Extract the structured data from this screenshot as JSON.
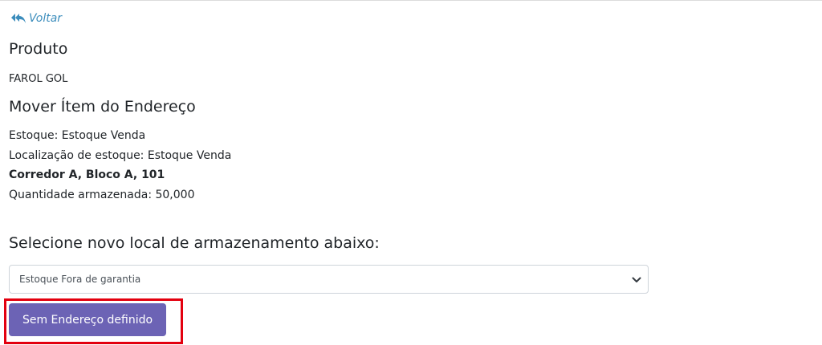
{
  "nav": {
    "back_label": "Voltar",
    "back_icon": "reply-all-icon",
    "link_color": "#3c8dbc"
  },
  "produto": {
    "heading": "Produto",
    "name": "FAROL GOL"
  },
  "mover": {
    "heading": "Mover Ítem do Endereço",
    "estoque": "Estoque: Estoque Venda",
    "localizacao": "Localização de estoque: Estoque Venda",
    "endereco": "Corredor A, Bloco A, 101",
    "quantidade": "Quantidade armazenada: 50,000"
  },
  "novo_local": {
    "heading": "Selecione novo local de armazenamento abaixo:",
    "select_value": "Estoque Fora de garantia",
    "select_icon": "chevron-down-icon"
  },
  "actions": {
    "no_address_button": "Sem Endereço definido",
    "button_color": "#6c63b5",
    "highlight_color": "#e3000f"
  }
}
